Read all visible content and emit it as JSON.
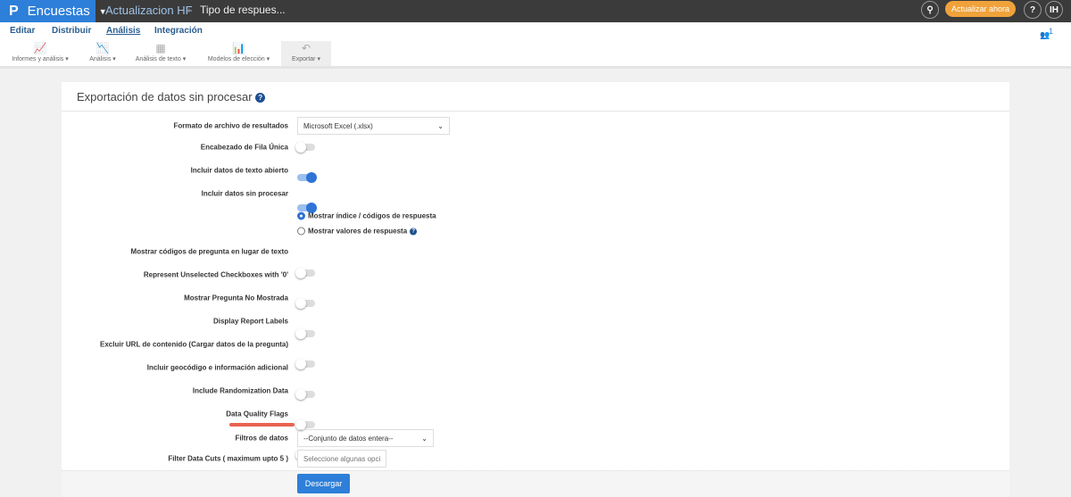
{
  "topbar": {
    "brand": "Encuestas",
    "project": "Actualizacion HF",
    "page": "Tipo de respues...",
    "update_label": "Actualizar ahora",
    "help": "?",
    "user_initials": "IH"
  },
  "nav": {
    "tabs": [
      "Editar",
      "Distribuir",
      "Análisis",
      "Integración"
    ],
    "active": "Análisis",
    "collaborators": "1"
  },
  "toolbar": [
    "Informes y análisis",
    "Análisis",
    "Análisis de texto",
    "Modelos de elección",
    "Exportar"
  ],
  "panel": {
    "title": "Exportación de datos sin procesar",
    "rows": [
      {
        "label": "Formato de archivo de resultados",
        "type": "select",
        "value": "Microsoft Excel (.xlsx)"
      },
      {
        "label": "Encabezado de Fila Única",
        "type": "toggle",
        "on": false
      },
      {
        "label": "Incluir datos de texto abierto",
        "type": "toggle",
        "on": true
      },
      {
        "label": "Incluir datos sin procesar",
        "type": "toggle",
        "on": true
      },
      {
        "label": "Mostrar códigos de pregunta en lugar de texto",
        "type": "toggle",
        "on": false
      },
      {
        "label": "Represent Unselected Checkboxes with '0'",
        "type": "toggle",
        "on": false
      },
      {
        "label": "Mostrar Pregunta No Mostrada",
        "type": "toggle",
        "on": false
      },
      {
        "label": "Display Report Labels",
        "type": "toggle",
        "on": false
      },
      {
        "label": "Excluir URL de contenido (Cargar datos de la pregunta)",
        "type": "toggle",
        "on": false
      },
      {
        "label": "Incluir geocódigo e información adicional",
        "type": "toggle",
        "on": false
      },
      {
        "label": "Include Randomization Data",
        "type": "toggle",
        "on": false
      },
      {
        "label": "Data Quality Flags",
        "type": "toggle",
        "on": true
      },
      {
        "label": "Filtros de datos",
        "type": "select",
        "value": "--Conjunto de datos entera--"
      },
      {
        "label": "Filter Data Cuts ( maximum upto 5 )",
        "type": "input",
        "placeholder": "Seleccione algunas opcior"
      }
    ],
    "radios": [
      {
        "label": "Mostrar índice / códigos de respuesta",
        "checked": true
      },
      {
        "label": "Mostrar valores de respuesta",
        "checked": false
      }
    ],
    "download": "Descargar"
  }
}
